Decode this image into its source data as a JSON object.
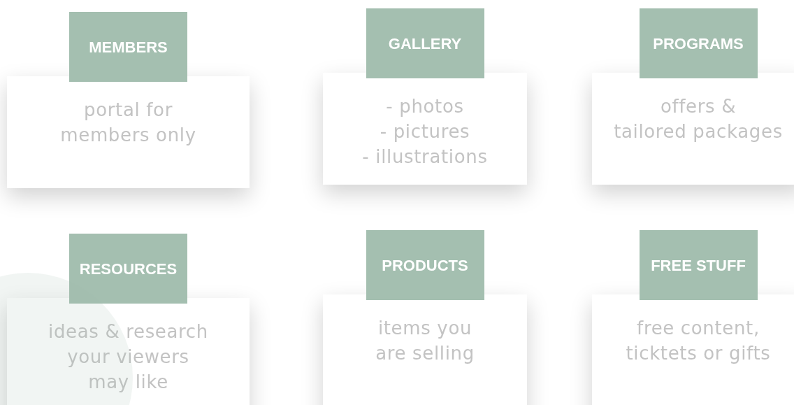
{
  "cards": [
    {
      "title": "MEMBERS",
      "text": "portal for\nmembers only"
    },
    {
      "title": "GALLERY",
      "text": "- photos\n- pictures\n- illustrations"
    },
    {
      "title": "PROGRAMS",
      "text": "offers &\ntailored packages"
    },
    {
      "title": "RESOURCES",
      "text": "ideas & research\nyour viewers\nmay like"
    },
    {
      "title": "PRODUCTS",
      "text": "items you\nare selling"
    },
    {
      "title": "FREE STUFF",
      "text": "free content,\nticktets or gifts"
    }
  ]
}
